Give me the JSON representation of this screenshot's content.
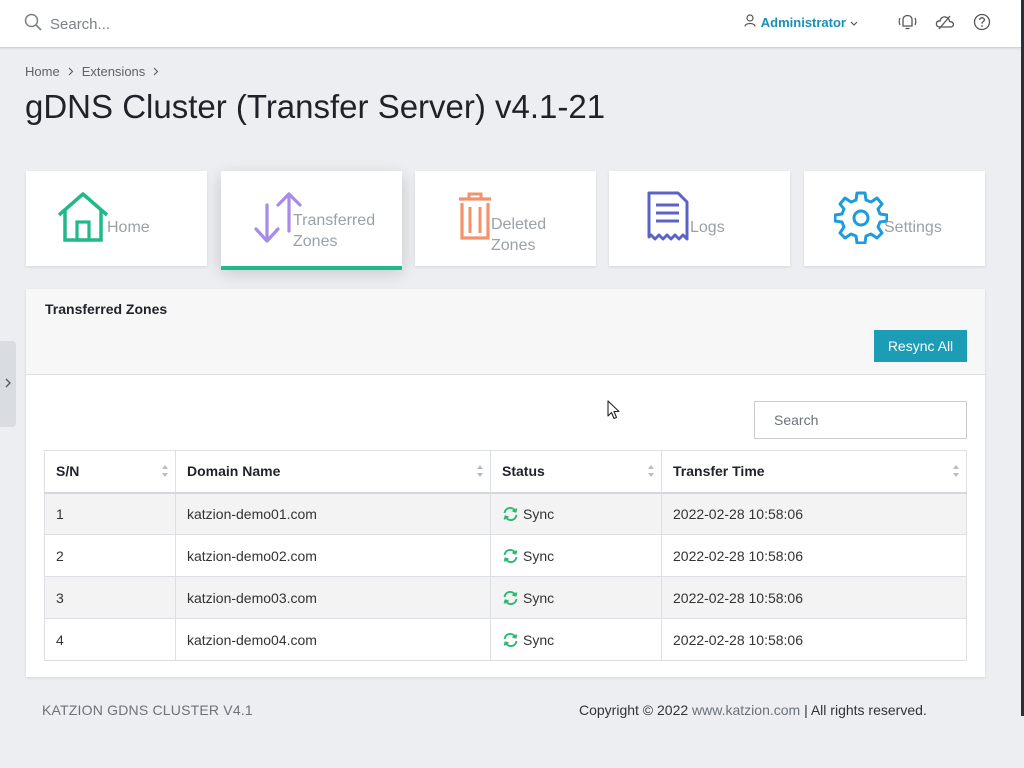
{
  "topbar": {
    "search_placeholder": "Search...",
    "user_label": "Administrator"
  },
  "breadcrumb": [
    "Home",
    "Extensions"
  ],
  "page_title": "gDNS Cluster (Transfer Server) v4.1-21",
  "tiles": [
    {
      "label_line1": "Home",
      "label_line2": "",
      "icon": "house-icon",
      "color": "#21b98b"
    },
    {
      "label_line1": "Transferred",
      "label_line2": "Zones",
      "icon": "transfer-arrows-icon",
      "color": "#a68be8",
      "active": true
    },
    {
      "label_line1": "Deleted",
      "label_line2": "Zones",
      "icon": "trash-icon",
      "color": "#f3926c"
    },
    {
      "label_line1": "Logs",
      "label_line2": "",
      "icon": "receipt-icon",
      "color": "#5d63c4"
    },
    {
      "label_line1": "Settings",
      "label_line2": "",
      "icon": "gear-icon",
      "color": "#1b9be0"
    }
  ],
  "panel": {
    "title": "Transferred Zones",
    "resync_label": "Resync All",
    "search_placeholder": "Search"
  },
  "table": {
    "headers": [
      "S/N",
      "Domain Name",
      "Status",
      "Transfer Time"
    ],
    "rows": [
      {
        "sn": "1",
        "domain": "katzion-demo01.com",
        "status": "Sync",
        "time": "2022-02-28 10:58:06"
      },
      {
        "sn": "2",
        "domain": "katzion-demo02.com",
        "status": "Sync",
        "time": "2022-02-28 10:58:06"
      },
      {
        "sn": "3",
        "domain": "katzion-demo03.com",
        "status": "Sync",
        "time": "2022-02-28 10:58:06"
      },
      {
        "sn": "4",
        "domain": "katzion-demo04.com",
        "status": "Sync",
        "time": "2022-02-28 10:58:06"
      }
    ]
  },
  "footer": {
    "left": "KATZION GDNS CLUSTER V4.1",
    "copyright": "Copyright © 2022",
    "link": "www.katzion.com",
    "rights": "| All rights reserved."
  },
  "colors": {
    "accent": "#1d9cb6",
    "active_underline": "#21b98b",
    "sync_icon": "#2bb673"
  }
}
